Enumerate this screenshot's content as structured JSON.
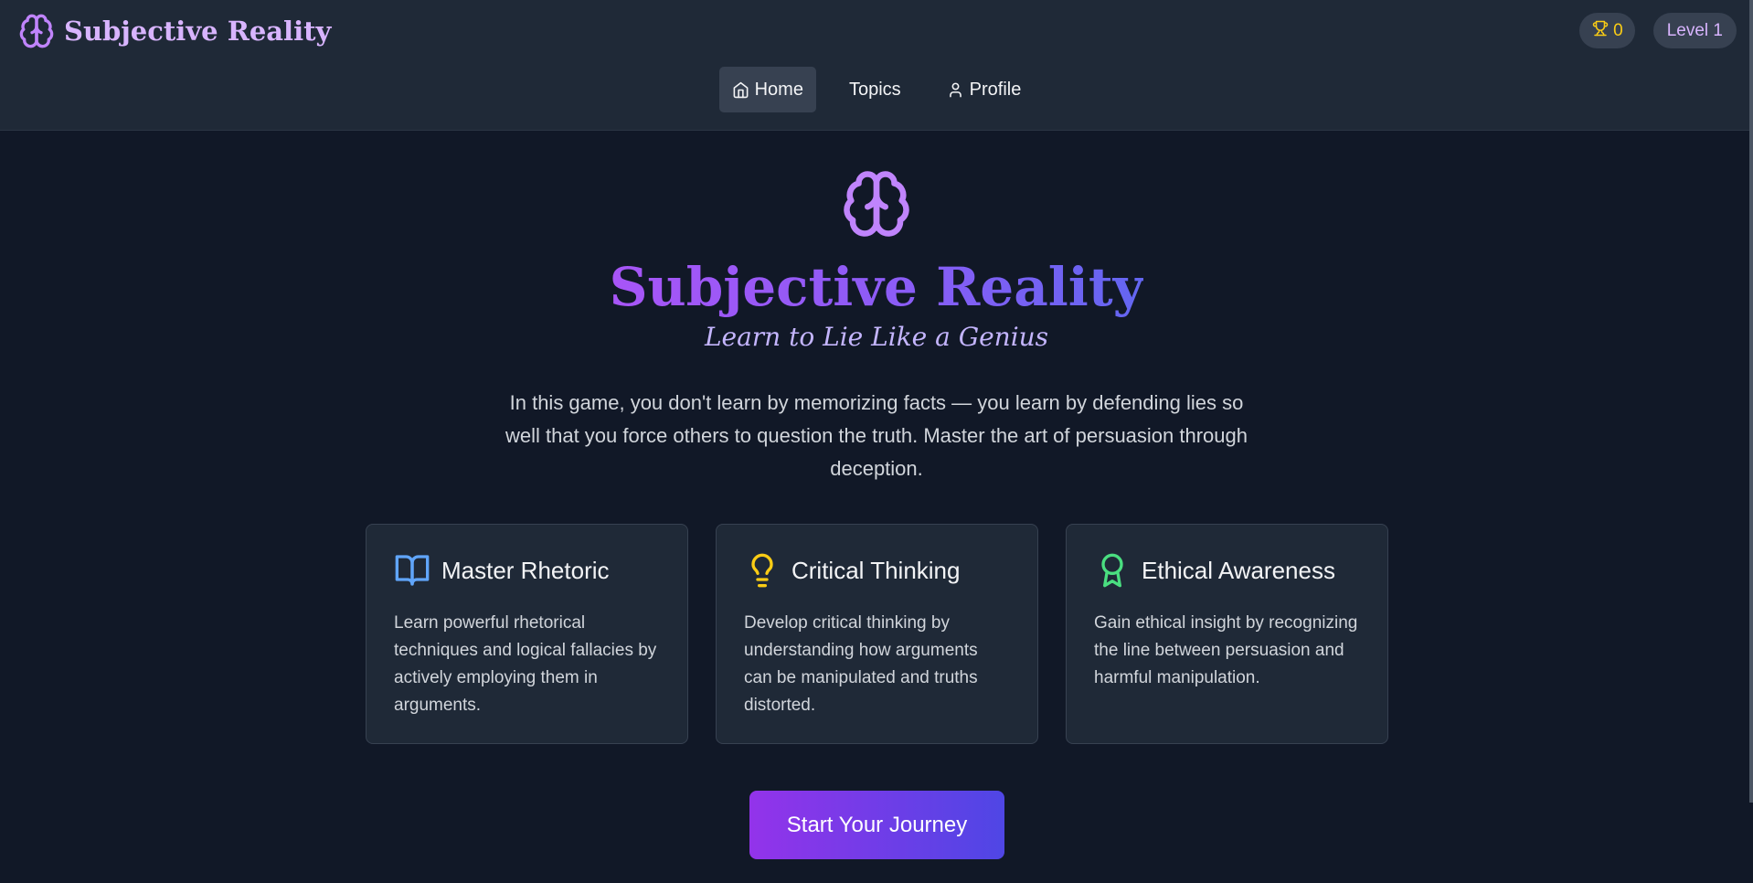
{
  "app": {
    "title": "Subjective Reality"
  },
  "header": {
    "trophy_count": "0",
    "level_label": "Level 1"
  },
  "nav": {
    "items": [
      {
        "label": "Home",
        "icon": "home-icon",
        "active": true
      },
      {
        "label": "Topics",
        "icon": "",
        "active": false
      },
      {
        "label": "Profile",
        "icon": "user-icon",
        "active": false
      }
    ]
  },
  "hero": {
    "icon": "brain-icon",
    "title": "Subjective Reality",
    "subtitle": "Learn to Lie Like a Genius",
    "description": "In this game, you don't learn by memorizing facts — you learn by defending lies so well that you force others to question the truth. Master the art of persuasion through deception."
  },
  "features": [
    {
      "icon": "book-open-icon",
      "icon_color": "#60a5fa",
      "title": "Master Rhetoric",
      "text": "Learn powerful rhetorical techniques and logical fallacies by actively employing them in arguments."
    },
    {
      "icon": "lightbulb-icon",
      "icon_color": "#facc15",
      "title": "Critical Thinking",
      "text": "Develop critical thinking by understanding how arguments can be manipulated and truths distorted."
    },
    {
      "icon": "award-icon",
      "icon_color": "#4ade80",
      "title": "Ethical Awareness",
      "text": "Gain ethical insight by recognizing the line between persuasion and harmful manipulation."
    }
  ],
  "cta": {
    "label": "Start Your Journey"
  },
  "colors": {
    "background": "#111827",
    "header": "#1f2937",
    "accent_purple": "#a855f7",
    "accent_indigo": "#4f46e5"
  }
}
